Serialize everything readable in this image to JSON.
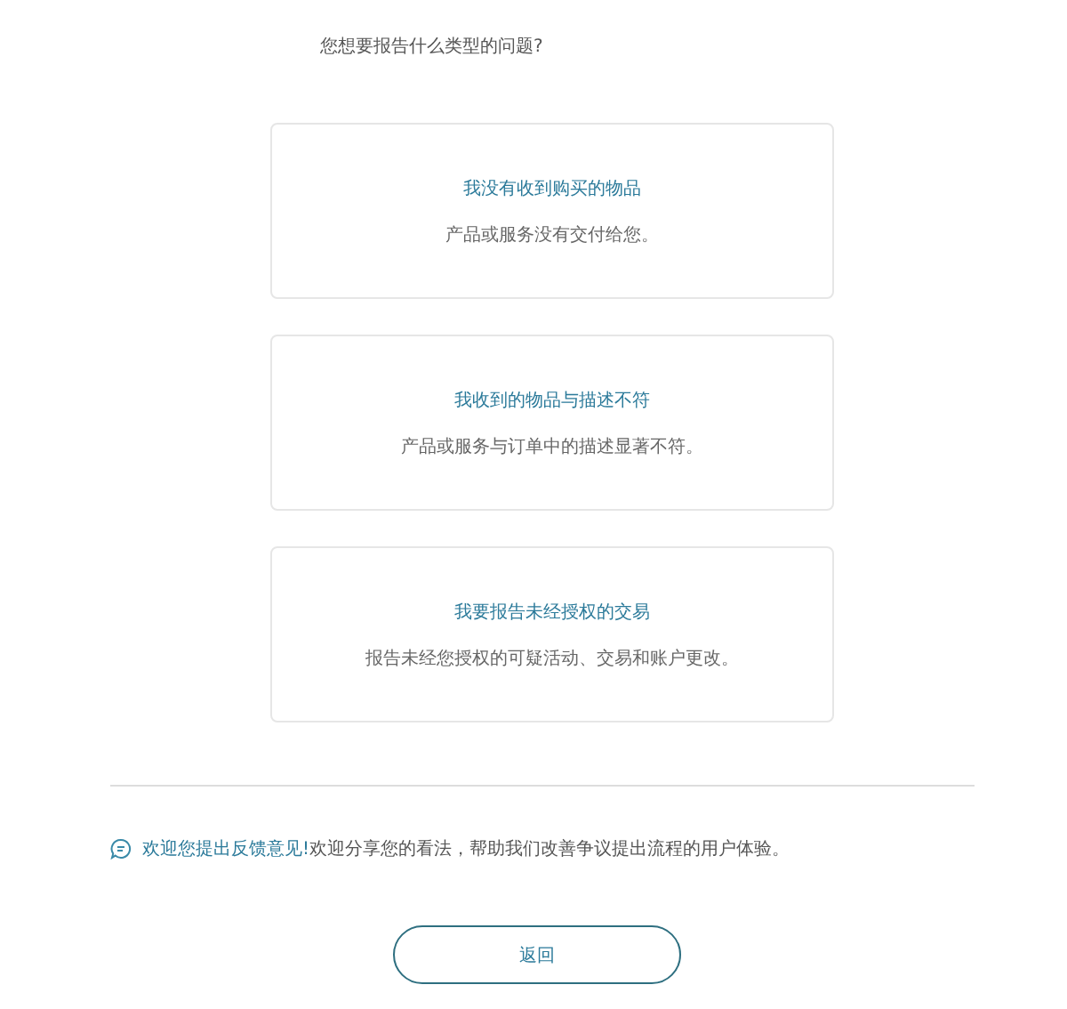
{
  "question": "您想要报告什么类型的问题?",
  "options": [
    {
      "title": "我没有收到购买的物品",
      "description": "产品或服务没有交付给您。"
    },
    {
      "title": "我收到的物品与描述不符",
      "description": "产品或服务与订单中的描述显著不符。"
    },
    {
      "title": "我要报告未经授权的交易",
      "description": "报告未经您授权的可疑活动、交易和账户更改。"
    }
  ],
  "feedback": {
    "link": "欢迎您提出反馈意见!",
    "text": "欢迎分享您的看法，帮助我们改善争议提出流程的用户体验。"
  },
  "back_button": "返回"
}
